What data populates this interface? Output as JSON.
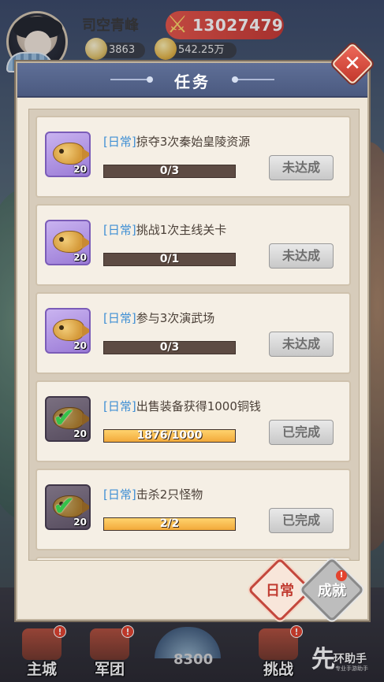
{
  "player": {
    "name": "司空青峰",
    "power": "13027479",
    "silver": "3863",
    "gold": "542.25万"
  },
  "dialog": {
    "title": "任务",
    "close_label": "✕"
  },
  "tasks": [
    {
      "tag": "[日常]",
      "text": "掠夺3次秦始皇陵资源",
      "progress_text": "0/3",
      "progress": 0,
      "reward_qty": "20",
      "status": "未达成",
      "done": false
    },
    {
      "tag": "[日常]",
      "text": "挑战1次主线关卡",
      "progress_text": "0/1",
      "progress": 0,
      "reward_qty": "20",
      "status": "未达成",
      "done": false
    },
    {
      "tag": "[日常]",
      "text": "参与3次演武场",
      "progress_text": "0/3",
      "progress": 0,
      "reward_qty": "20",
      "status": "未达成",
      "done": false
    },
    {
      "tag": "[日常]",
      "text": "出售装备获得1000铜钱",
      "progress_text": "1876/1000",
      "progress": 1,
      "reward_qty": "20",
      "status": "已完成",
      "done": true
    },
    {
      "tag": "[日常]",
      "text": "击杀2只怪物",
      "progress_text": "2/2",
      "progress": 1,
      "reward_qty": "20",
      "status": "已完成",
      "done": true
    }
  ],
  "tabs": {
    "daily": "日常",
    "achievement": "成就",
    "achievement_badge": "!"
  },
  "nav": {
    "main_city": "主城",
    "legion": "军团",
    "challenge": "挑战",
    "center_counter": "8300",
    "badge": "!"
  },
  "watermark": {
    "mark": "先",
    "text": "环助手",
    "sub": "专业手游助手"
  },
  "colors": {
    "header": "#4b5a80",
    "progress_fill": "#f2a93a",
    "tag_blue": "#3f8fd4",
    "close_red": "#c2372b"
  }
}
